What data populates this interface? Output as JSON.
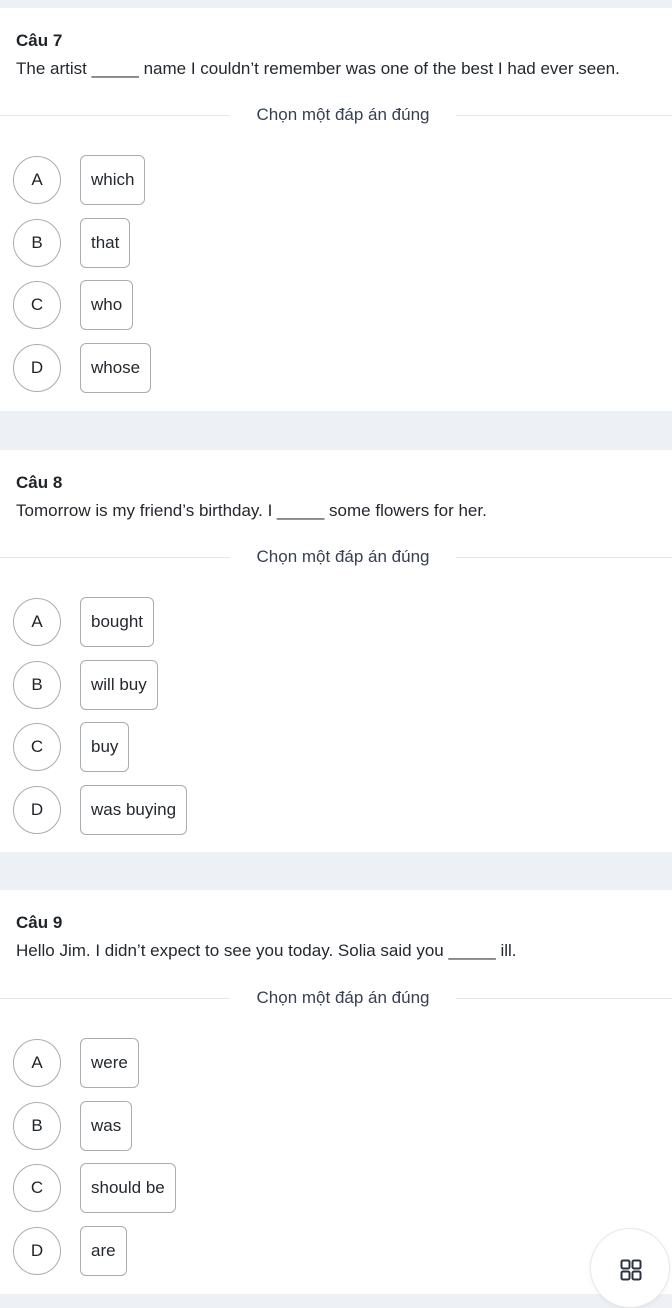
{
  "divider_label": "Chọn một đáp án đúng",
  "questions": [
    {
      "title": "Câu 7",
      "text": "The artist _____ name I couldn’t remember was one of the best I had ever seen.",
      "options": [
        {
          "letter": "A",
          "text": "which"
        },
        {
          "letter": "B",
          "text": "that"
        },
        {
          "letter": "C",
          "text": "who"
        },
        {
          "letter": "D",
          "text": "whose"
        }
      ]
    },
    {
      "title": "Câu 8",
      "text": "Tomorrow is my friend’s birthday. I _____ some flowers for her.",
      "options": [
        {
          "letter": "A",
          "text": "bought"
        },
        {
          "letter": "B",
          "text": "will buy"
        },
        {
          "letter": "C",
          "text": "buy"
        },
        {
          "letter": "D",
          "text": "was buying"
        }
      ]
    },
    {
      "title": "Câu 9",
      "text": "Hello Jim. I didn’t expect to see you today. Solia said you _____ ill.",
      "options": [
        {
          "letter": "A",
          "text": "were"
        },
        {
          "letter": "B",
          "text": "was"
        },
        {
          "letter": "C",
          "text": "should be"
        },
        {
          "letter": "D",
          "text": "are"
        }
      ]
    }
  ],
  "floating_button": {
    "icon": "grid-icon"
  }
}
